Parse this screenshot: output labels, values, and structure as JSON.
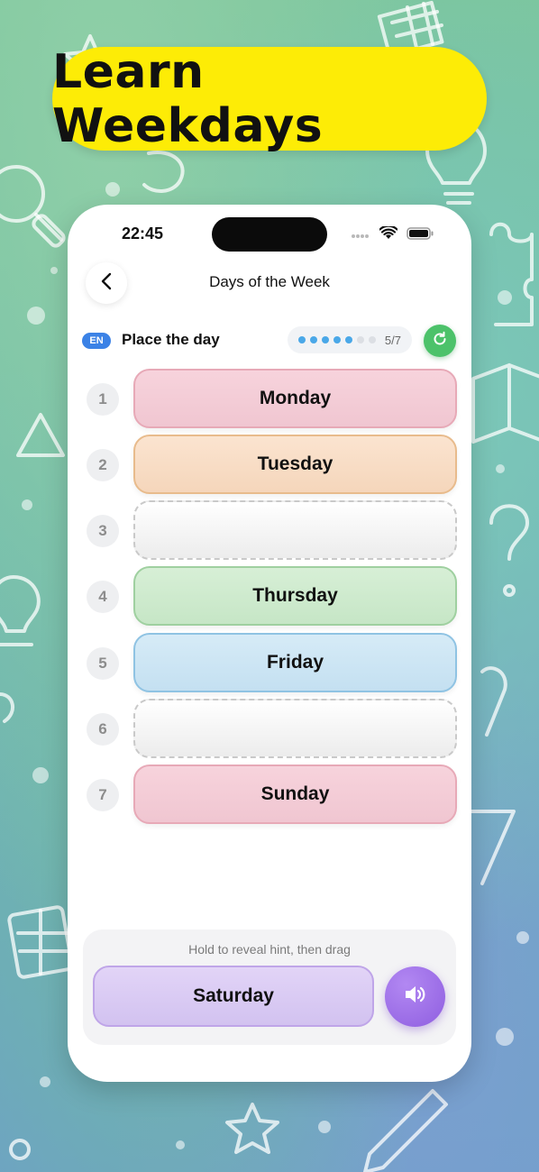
{
  "banner": {
    "title": "Learn Weekdays"
  },
  "status_bar": {
    "time": "22:45"
  },
  "nav": {
    "title": "Days of the Week"
  },
  "task": {
    "language_badge": "EN",
    "label": "Place the day",
    "progress": {
      "count_text": "5/7",
      "filled": 5,
      "total": 7
    }
  },
  "slots": [
    {
      "number": "1",
      "day": "Monday",
      "style": "pink"
    },
    {
      "number": "2",
      "day": "Tuesday",
      "style": "orange"
    },
    {
      "number": "3",
      "day": "",
      "style": "empty"
    },
    {
      "number": "4",
      "day": "Thursday",
      "style": "green"
    },
    {
      "number": "5",
      "day": "Friday",
      "style": "blue"
    },
    {
      "number": "6",
      "day": "",
      "style": "empty"
    },
    {
      "number": "7",
      "day": "Sunday",
      "style": "pink"
    }
  ],
  "bottom": {
    "hint": "Hold to reveal hint, then drag",
    "draggable_day": "Saturday"
  },
  "colors": {
    "banner_bg": "#fdec06",
    "accent_blue": "#3b82e6",
    "reset_green": "#4cc26a",
    "speaker_purple": "#9b6be6"
  },
  "icons": [
    "back-chevron-icon",
    "wifi-icon",
    "battery-icon",
    "refresh-icon",
    "speaker-icon"
  ]
}
